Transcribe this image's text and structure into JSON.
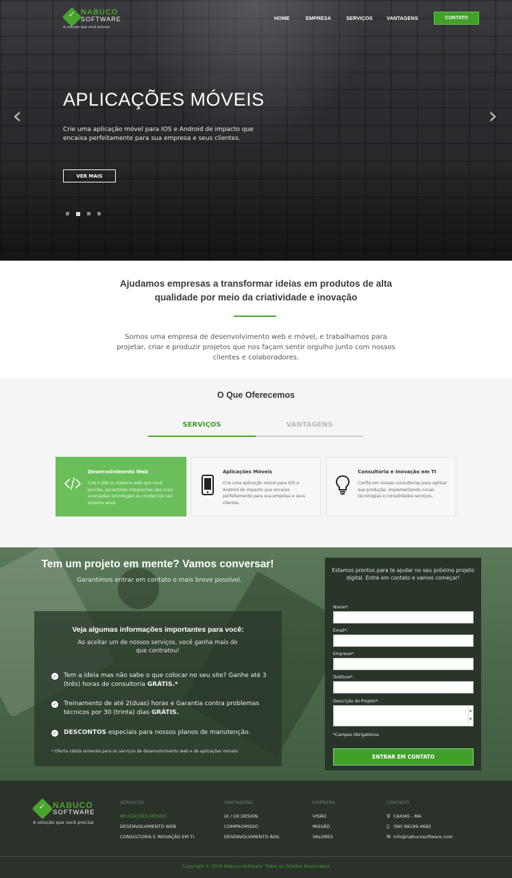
{
  "brand": {
    "name_line1": "NABUCO",
    "name_line2": "SOFTWARE",
    "tagline": "A solução que você precisa"
  },
  "nav": {
    "items": [
      "HOME",
      "EMPRESA",
      "SERVIÇOS",
      "VANTAGENS"
    ],
    "cta": "CONTATO"
  },
  "hero": {
    "title": "APLICAÇÕES MÓVEIS",
    "description": "Crie uma aplicação móvel para IOS e Android de impacto que encaixa perfeitamente para sua empresa e seus clientes.",
    "button": "VER MAIS",
    "prev_icon": "chevron-left-icon",
    "next_icon": "chevron-right-icon",
    "slides": 4,
    "active_slide": 2
  },
  "intro": {
    "heading": "Ajudamos empresas a transformar ideias em produtos de alta qualidade por meio da criatividade e inovação",
    "text": "Somos uma empresa de desenvolvimento web e móvel, e trabalhamos para projetar, criar e produzir projetos que nos façam sentir orgulho junto com nossos clientes e colaboradores."
  },
  "offer": {
    "heading": "O Que Oferecemos",
    "tabs": [
      "SERVIÇOS",
      "VANTAGENS"
    ],
    "cards": [
      {
        "icon": "code-icon",
        "title": "Desenvolvimento Web",
        "text": "Crie o site ou sistema web que você precisa, garantindo integrações das mais avançadas tecnologias ou modernize seu sistema atual."
      },
      {
        "icon": "smartphone-icon",
        "title": "Aplicações Móveis",
        "text": "Crie uma aplicação móvel para IOS e Android de impacto que encaixa perfeitamente para sua empresa e seus clientes."
      },
      {
        "icon": "lightbulb-icon",
        "title": "Consultoria e Inovação em TI",
        "text": "Confie em nossas consultorias para agilizar sua produção, implementando novas tecnologias e consolidades serviços."
      }
    ]
  },
  "contact": {
    "heading": "Tem um  projeto em mente? Vamos conversar!",
    "subheading": "Garantimos entrar em contato o mais breve possível.",
    "info_title": "Veja algumas informações importantes para você:",
    "info_lead": "Ao aceitar um de nossos serviços, você ganha mais do que contratou!",
    "items": [
      {
        "text": "Tem a ideia mas não sabe o que colocar no seu site? Ganhe até 3 (três) horas de consultoria ",
        "bold": "GRÁTIS.*"
      },
      {
        "text": "Treinamento de até 2(duas) horas e Garantia contra problemas técnicos por 30 (trinta) dias ",
        "bold": "GRÁTIS."
      },
      {
        "bold_first": "DESCONTOS",
        "text": " especiais para nossos planos de manutenção."
      }
    ],
    "note": "* Oferta válida somente para os serviços de desenvolvimento web e de aplicações móveis.",
    "form": {
      "intro": "Estamos prontos para te ajudar no seu próximo projeto digital. Entre em contato e vamos começar!",
      "fields": [
        "Nome*:",
        "Email*:",
        "Empresa*:",
        "Telefone*:",
        "Descrição do Projeto*:"
      ],
      "required_note": "*Campos Obrigatórios.",
      "submit": "ENTRAR EM CONTATO"
    }
  },
  "footer": {
    "cols": [
      {
        "heading": "SERVIÇOS",
        "links": [
          "APLICAÇÕES MÓVEIS",
          "DESENVOLVIMENTO WEB",
          "CONSULTORIA E INOVAÇÃO EM TI"
        ]
      },
      {
        "heading": "VANTAGENS",
        "links": [
          "UI / UX DESIGN",
          "COMPROMISSO",
          "DESENVOLVIMENTO ÁGIL"
        ]
      },
      {
        "heading": "EMPRESA",
        "links": [
          "VISÃO",
          "MISSÃO",
          "VALORES"
        ]
      },
      {
        "heading": "CONTATO",
        "links": [
          "CAXIAS - MA",
          "(99) 98189-4682",
          "info@nabucosoftware.com"
        ]
      }
    ],
    "contact_icons": [
      "location-icon",
      "phone-icon",
      "email-icon"
    ],
    "copyright": "Copyright © 2019 Nabuco Software. Todos os Direitos Reservados"
  },
  "colors": {
    "accent": "#3fa02a",
    "dark_green": "#283528",
    "card_active": "#6bbf5b"
  }
}
